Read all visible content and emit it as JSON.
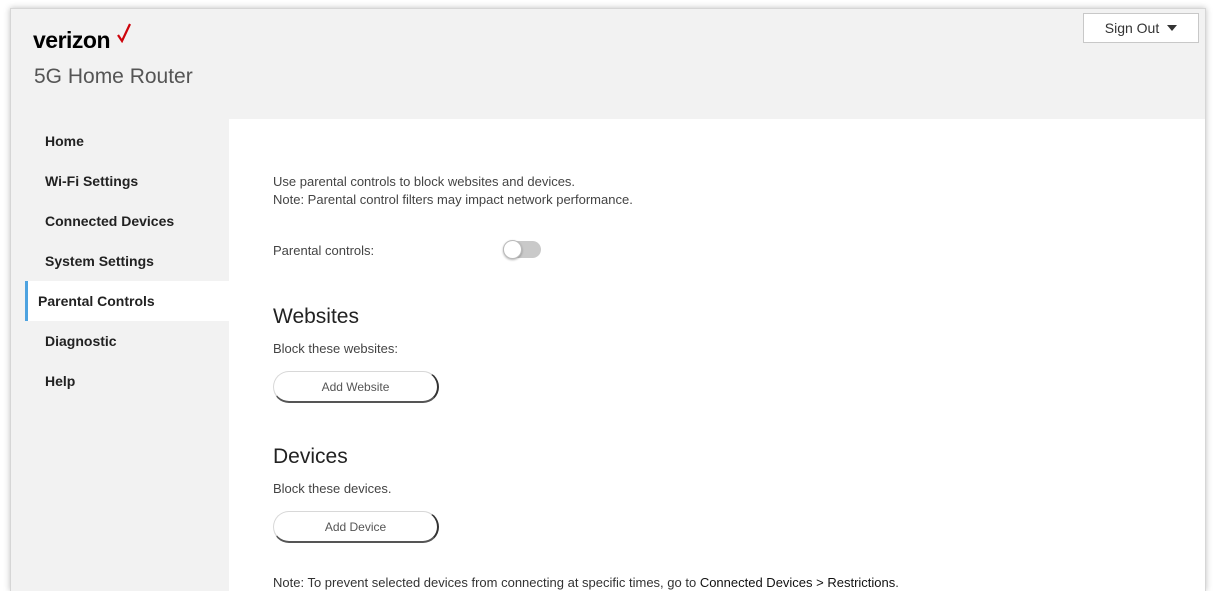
{
  "header": {
    "brand": "verizon",
    "product": "5G Home Router",
    "signout_label": "Sign Out"
  },
  "sidebar": {
    "items": [
      {
        "label": "Home"
      },
      {
        "label": "Wi-Fi Settings"
      },
      {
        "label": "Connected Devices"
      },
      {
        "label": "System Settings"
      },
      {
        "label": "Parental Controls"
      },
      {
        "label": "Diagnostic"
      },
      {
        "label": "Help"
      }
    ],
    "active_index": 4
  },
  "main": {
    "intro_line1": "Use parental controls to block websites and devices.",
    "intro_line2": "Note: Parental control filters may impact network performance.",
    "parental_controls_label": "Parental controls:",
    "parental_controls_enabled": false,
    "websites": {
      "title": "Websites",
      "subtitle": "Block these websites:",
      "button": "Add Website"
    },
    "devices": {
      "title": "Devices",
      "subtitle": "Block these devices.",
      "button": "Add Device"
    },
    "note_prefix": "Note: To prevent selected devices from connecting at specific times, go to ",
    "note_link": "Connected Devices > Restrictions",
    "note_suffix": "."
  },
  "colors": {
    "brand_check": "#cd040b",
    "active_accent": "#4ea3e0",
    "sidebar_bg": "#f2f2f2",
    "content_bg": "#ffffff"
  },
  "icons": {
    "brand_mark": "checkmark-icon",
    "signout_caret": "caret-down-icon"
  }
}
